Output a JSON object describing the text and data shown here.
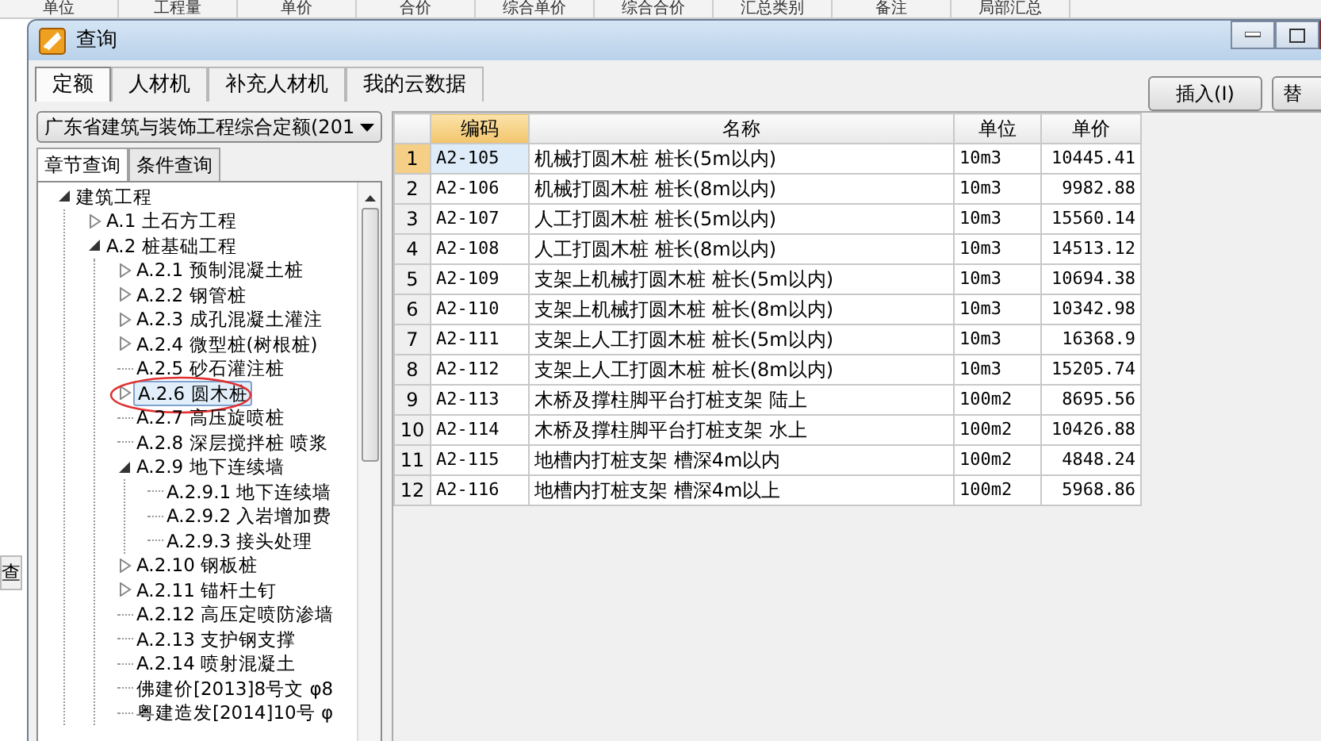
{
  "background_app": {
    "header_columns": [
      "单位",
      "工程量",
      "单价",
      "合价",
      "综合单价",
      "综合合价",
      "汇总类别",
      "备注",
      "局部汇总"
    ],
    "side_label": "查"
  },
  "window": {
    "title": "查询"
  },
  "tabs": [
    {
      "label": "定额",
      "selected": true
    },
    {
      "label": "人材机",
      "selected": false
    },
    {
      "label": "补充人材机",
      "selected": false
    },
    {
      "label": "我的云数据",
      "selected": false
    }
  ],
  "toolbar_buttons": [
    "插入(I)",
    "替"
  ],
  "library_select": {
    "value": "广东省建筑与装饰工程综合定额(201"
  },
  "subtabs": [
    {
      "label": "章节查询",
      "selected": true
    },
    {
      "label": "条件查询",
      "selected": false
    }
  ],
  "tree": [
    {
      "label": "建筑工程",
      "expanded": true,
      "selected": false,
      "circled": false,
      "children": [
        {
          "label": "A.1 土石方工程",
          "expanded": false,
          "selected": false,
          "circled": false
        },
        {
          "label": "A.2 桩基础工程",
          "expanded": true,
          "selected": false,
          "circled": false,
          "children": [
            {
              "label": "A.2.1 预制混凝土桩",
              "expanded": false,
              "selected": false,
              "circled": false
            },
            {
              "label": "A.2.2 钢管桩",
              "expanded": false,
              "selected": false,
              "circled": false
            },
            {
              "label": "A.2.3 成孔混凝土灌注",
              "expanded": false,
              "selected": false,
              "circled": false
            },
            {
              "label": "A.2.4 微型桩(树根桩)",
              "expanded": false,
              "selected": false,
              "circled": false
            },
            {
              "label": "A.2.5 砂石灌注桩",
              "selected": false,
              "circled": false
            },
            {
              "label": "A.2.6 圆木桩",
              "expanded": false,
              "selected": true,
              "circled": true
            },
            {
              "label": "A.2.7 高压旋喷桩",
              "selected": false,
              "circled": false
            },
            {
              "label": "A.2.8 深层搅拌桩 喷浆",
              "selected": false,
              "circled": false
            },
            {
              "label": "A.2.9 地下连续墙",
              "expanded": true,
              "selected": false,
              "circled": false,
              "children": [
                {
                  "label": "A.2.9.1 地下连续墙",
                  "selected": false,
                  "circled": false
                },
                {
                  "label": "A.2.9.2 入岩增加费",
                  "selected": false,
                  "circled": false
                },
                {
                  "label": "A.2.9.3 接头处理",
                  "selected": false,
                  "circled": false
                }
              ]
            },
            {
              "label": "A.2.10 钢板桩",
              "expanded": false,
              "selected": false,
              "circled": false
            },
            {
              "label": "A.2.11 锚杆土钉",
              "expanded": false,
              "selected": false,
              "circled": false
            },
            {
              "label": "A.2.12 高压定喷防渗墙",
              "selected": false,
              "circled": false
            },
            {
              "label": "A.2.13 支护钢支撑",
              "selected": false,
              "circled": false
            },
            {
              "label": "A.2.14 喷射混凝土",
              "selected": false,
              "circled": false
            },
            {
              "label": "佛建价[2013]8号文 φ8",
              "selected": false,
              "circled": false
            },
            {
              "label": "粤建造发[2014]10号 φ",
              "selected": false,
              "circled": false
            }
          ]
        }
      ]
    }
  ],
  "table": {
    "columns": [
      {
        "label": "编码",
        "selected": true
      },
      {
        "label": "名称",
        "selected": false
      },
      {
        "label": "单位",
        "selected": false
      },
      {
        "label": "单价",
        "selected": false
      }
    ],
    "rows": [
      {
        "index": "1",
        "code": "A2-105",
        "name": "机械打圆木桩 桩长(5m以内)",
        "unit": "10m3",
        "price": "10445.41",
        "selected": true
      },
      {
        "index": "2",
        "code": "A2-106",
        "name": "机械打圆木桩 桩长(8m以内)",
        "unit": "10m3",
        "price": "9982.88",
        "selected": false
      },
      {
        "index": "3",
        "code": "A2-107",
        "name": "人工打圆木桩 桩长(5m以内)",
        "unit": "10m3",
        "price": "15560.14",
        "selected": false
      },
      {
        "index": "4",
        "code": "A2-108",
        "name": "人工打圆木桩 桩长(8m以内)",
        "unit": "10m3",
        "price": "14513.12",
        "selected": false
      },
      {
        "index": "5",
        "code": "A2-109",
        "name": "支架上机械打圆木桩 桩长(5m以内)",
        "unit": "10m3",
        "price": "10694.38",
        "selected": false
      },
      {
        "index": "6",
        "code": "A2-110",
        "name": "支架上机械打圆木桩 桩长(8m以内)",
        "unit": "10m3",
        "price": "10342.98",
        "selected": false
      },
      {
        "index": "7",
        "code": "A2-111",
        "name": "支架上人工打圆木桩 桩长(5m以内)",
        "unit": "10m3",
        "price": "16368.9",
        "selected": false
      },
      {
        "index": "8",
        "code": "A2-112",
        "name": "支架上人工打圆木桩 桩长(8m以内)",
        "unit": "10m3",
        "price": "15205.74",
        "selected": false
      },
      {
        "index": "9",
        "code": "A2-113",
        "name": "木桥及撑柱脚平台打桩支架 陆上",
        "unit": "100m2",
        "price": "8695.56",
        "selected": false
      },
      {
        "index": "10",
        "code": "A2-114",
        "name": "木桥及撑柱脚平台打桩支架 水上",
        "unit": "100m2",
        "price": "10426.88",
        "selected": false
      },
      {
        "index": "11",
        "code": "A2-115",
        "name": "地槽内打桩支架 槽深4m以内",
        "unit": "100m2",
        "price": "4848.24",
        "selected": false
      },
      {
        "index": "12",
        "code": "A2-116",
        "name": "地槽内打桩支架 槽深4m以上",
        "unit": "100m2",
        "price": "5968.86",
        "selected": false
      }
    ]
  }
}
